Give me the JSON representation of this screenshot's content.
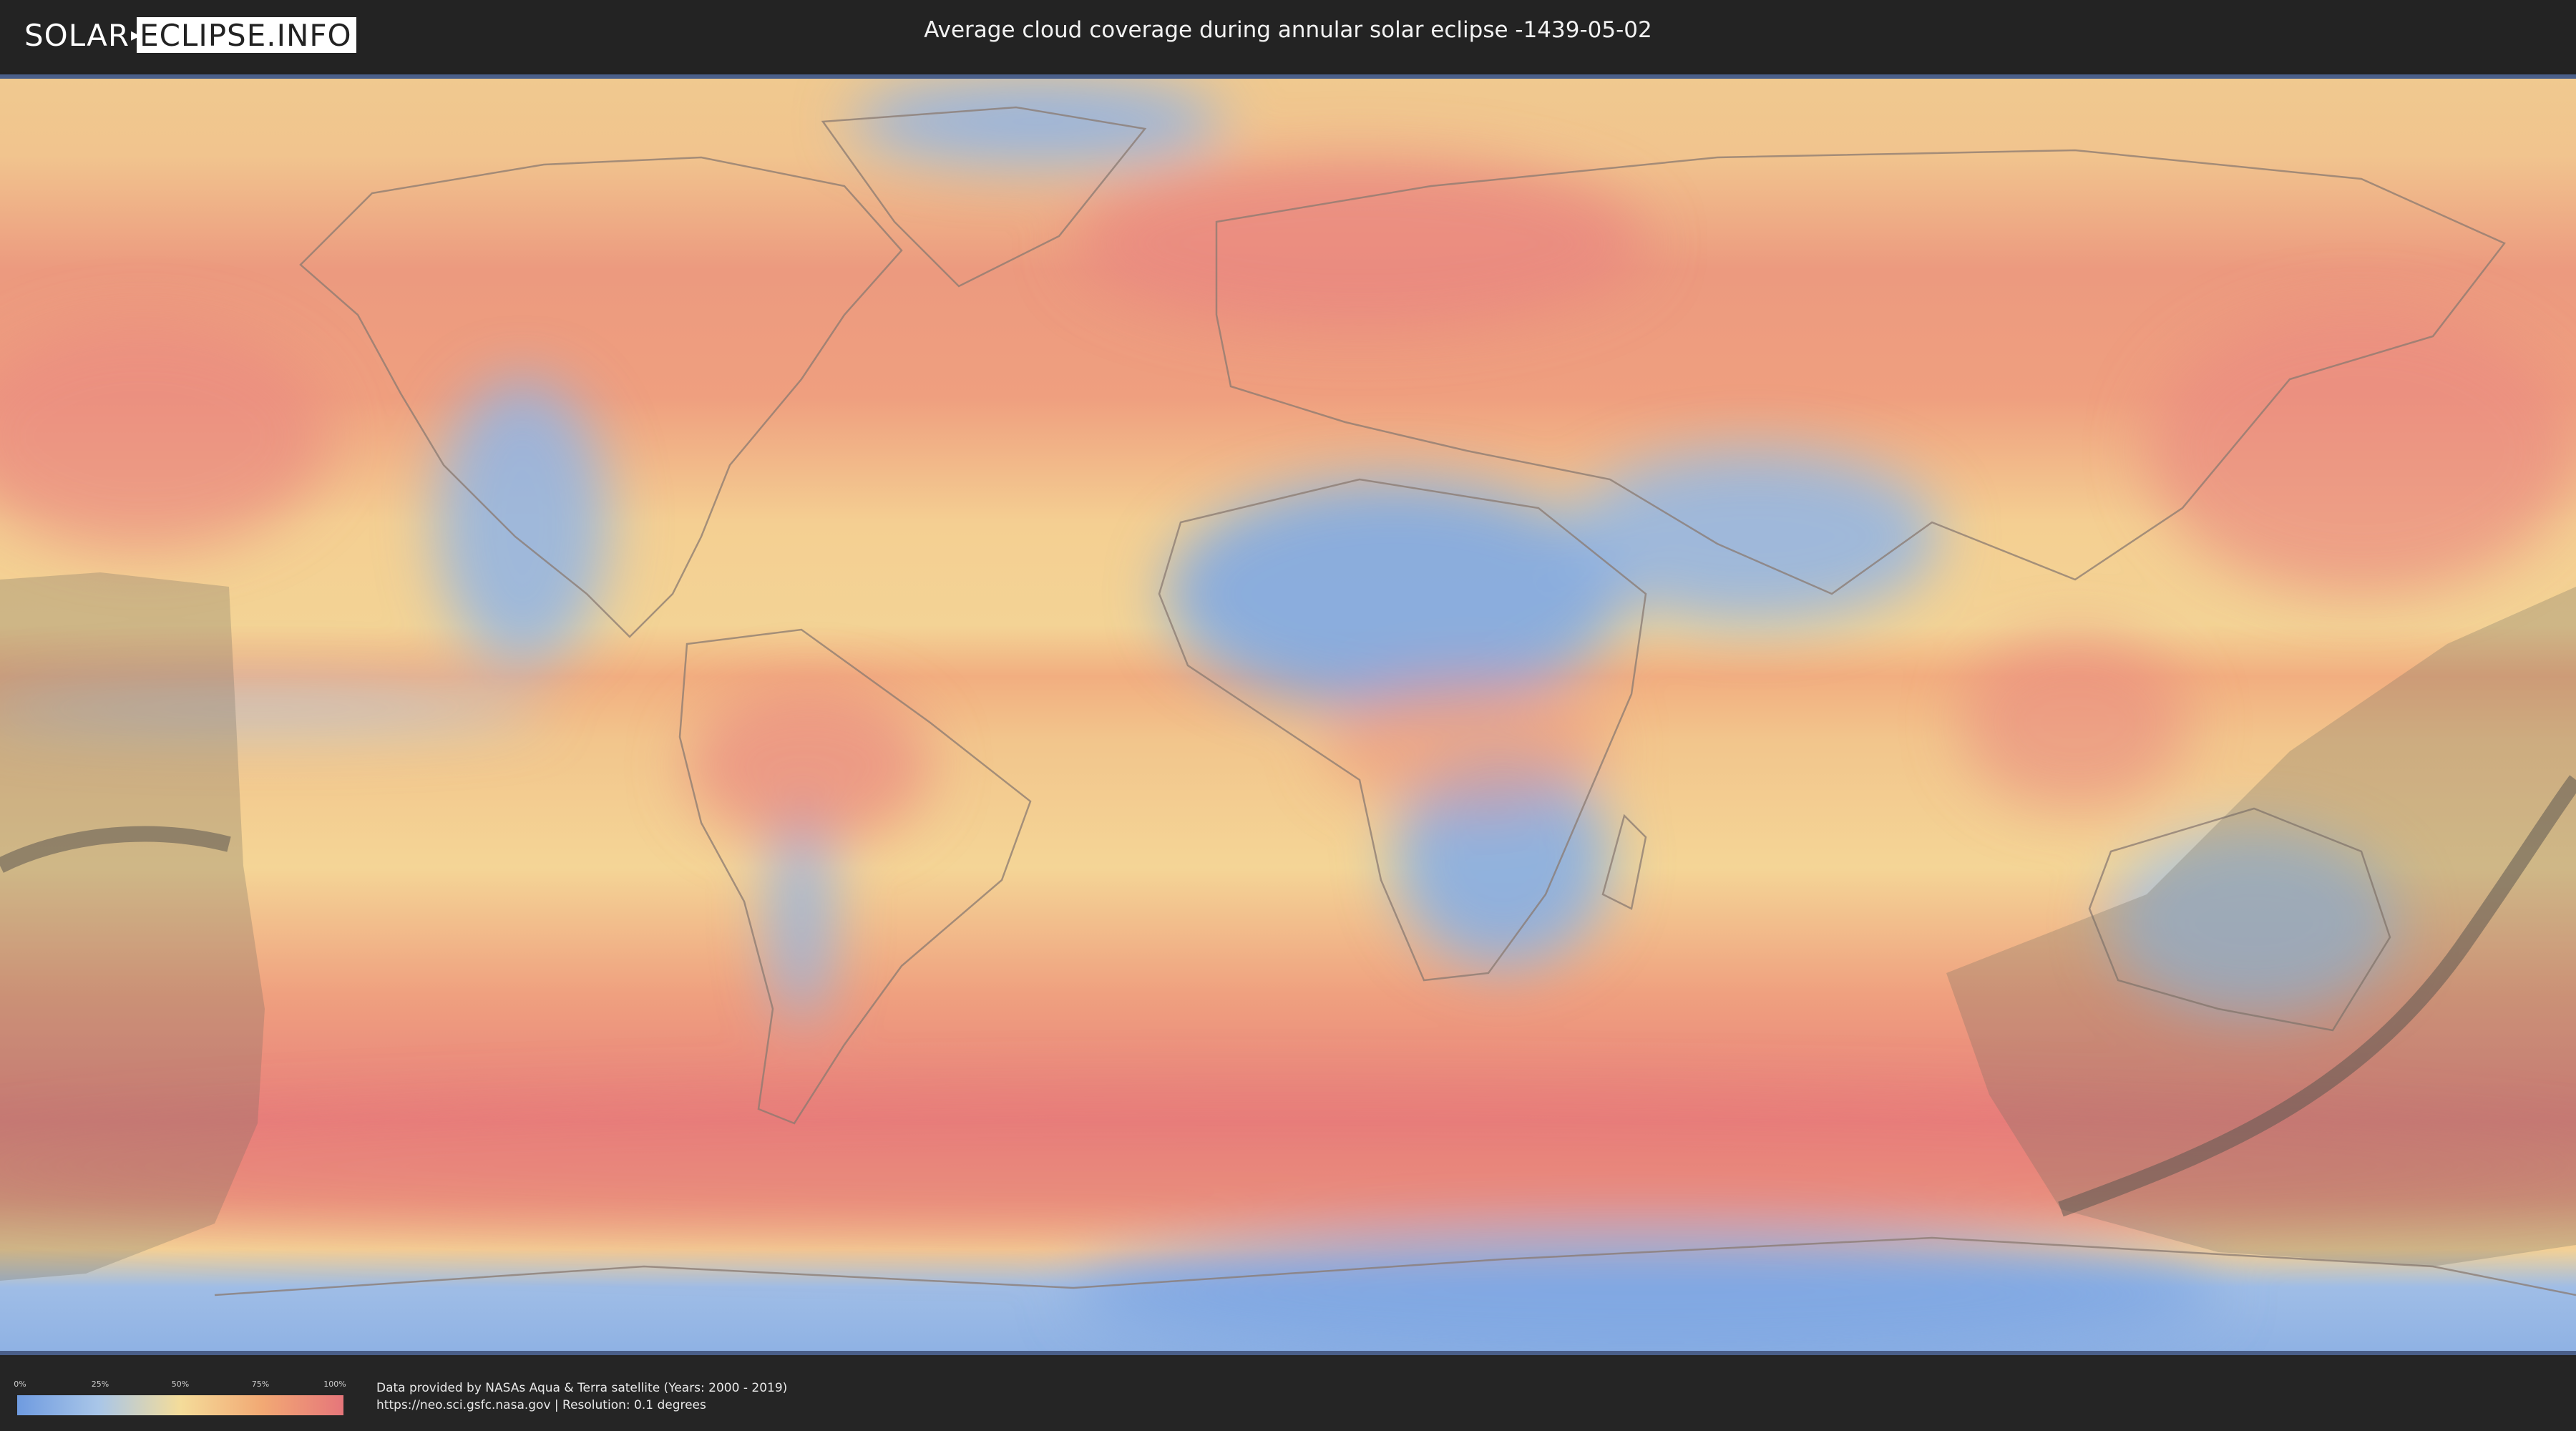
{
  "header": {
    "logo_left": "SOLAR",
    "logo_right": "ECLIPSE.INFO",
    "title": "Average cloud coverage during annular solar eclipse -1439-05-02"
  },
  "legend": {
    "ticks": [
      "0%",
      "25%",
      "50%",
      "75%",
      "100%"
    ],
    "colors": [
      "#6f9be0",
      "#a9c6e8",
      "#f4dc9a",
      "#f2a974",
      "#e6767a"
    ]
  },
  "footer": {
    "line1": "Data provided by NASAs Aqua & Terra satellite (Years: 2000 - 2019)",
    "line2": "https://neo.sci.gsfc.nasa.gov | Resolution: 0.1 degrees"
  },
  "map": {
    "projection": "equirectangular",
    "overlay": "eclipse visibility region with annular path",
    "colors": {
      "low_cloud": "#7fa6e2",
      "mid_cloud": "#f3d49a",
      "high_cloud": "#e88a80",
      "coastline": "#8a7a70",
      "shadow": "#6e6a60"
    }
  }
}
